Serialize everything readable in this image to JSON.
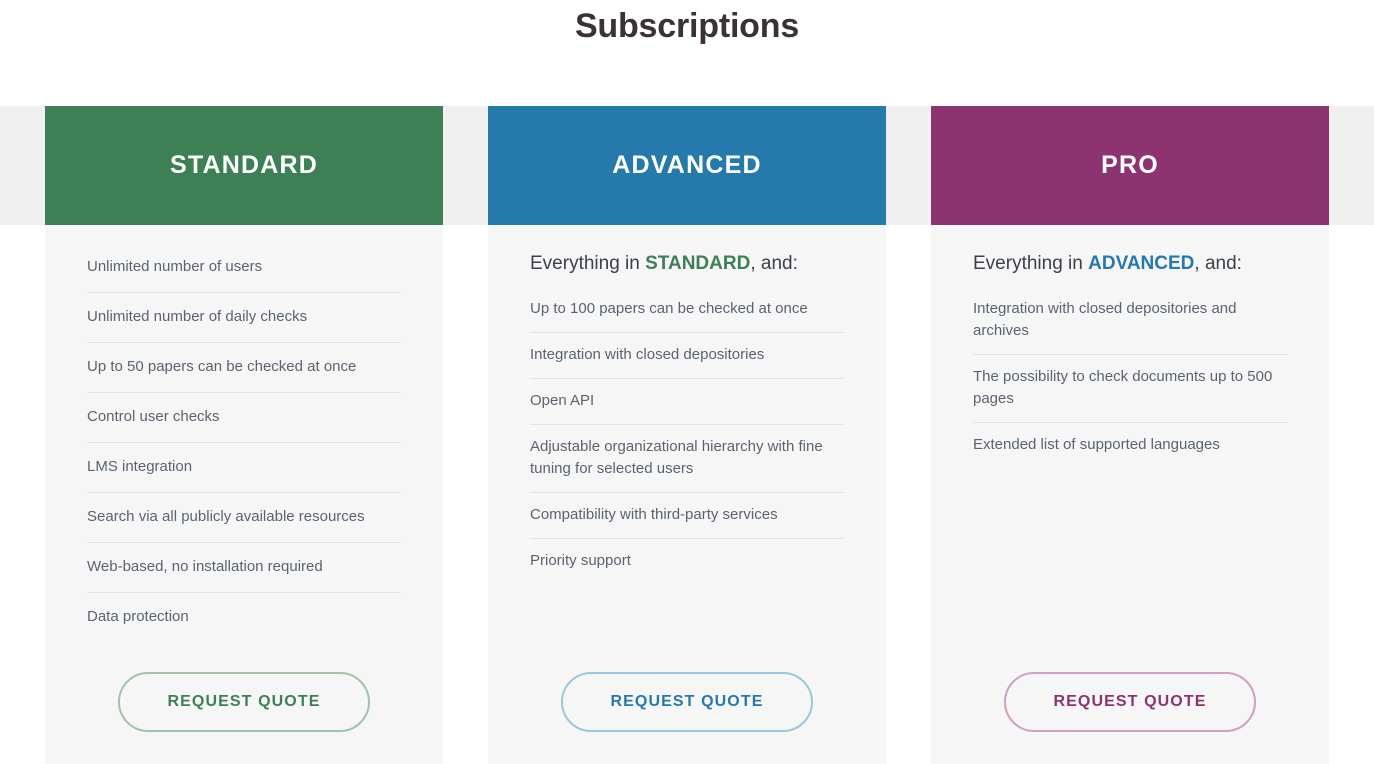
{
  "page": {
    "title": "Subscriptions"
  },
  "colors": {
    "standard": "#3d8055",
    "advanced": "#2579ab",
    "pro": "#8d3370",
    "title_text": "#3b3235",
    "band_background": "#f0f0f0",
    "card_background": "#f6f6f6",
    "feature_text": "#5a6470",
    "divider": "#e3e3e3"
  },
  "plans": [
    {
      "id": "standard",
      "name": "STANDARD",
      "intro": null,
      "intro_prefix": null,
      "intro_highlight": null,
      "intro_suffix": null,
      "features": [
        "Unlimited number of users",
        "Unlimited number of daily checks",
        "Up to 50 papers can be checked at once",
        "Control user checks",
        "LMS integration",
        "Search via all publicly available resources",
        "Web-based, no installation required",
        "Data protection"
      ],
      "cta_label": "REQUEST QUOTE"
    },
    {
      "id": "advanced",
      "name": "ADVANCED",
      "intro_prefix": "Everything in ",
      "intro_highlight": "STANDARD",
      "intro_suffix": ", and:",
      "features": [
        "Up to 100 papers can be checked at once",
        "Integration with closed depositories",
        "Open API",
        "Adjustable organizational hierarchy with fine tuning for selected users",
        "Compatibility with third-party services",
        "Priority support"
      ],
      "cta_label": "REQUEST QUOTE"
    },
    {
      "id": "pro",
      "name": "PRO",
      "intro_prefix": "Everything in ",
      "intro_highlight": "ADVANCED",
      "intro_suffix": ", and:",
      "features": [
        "Integration with closed depositories and archives",
        "The possibility to check documents up to 500 pages",
        "Extended list of supported languages"
      ],
      "cta_label": "REQUEST QUOTE"
    }
  ]
}
